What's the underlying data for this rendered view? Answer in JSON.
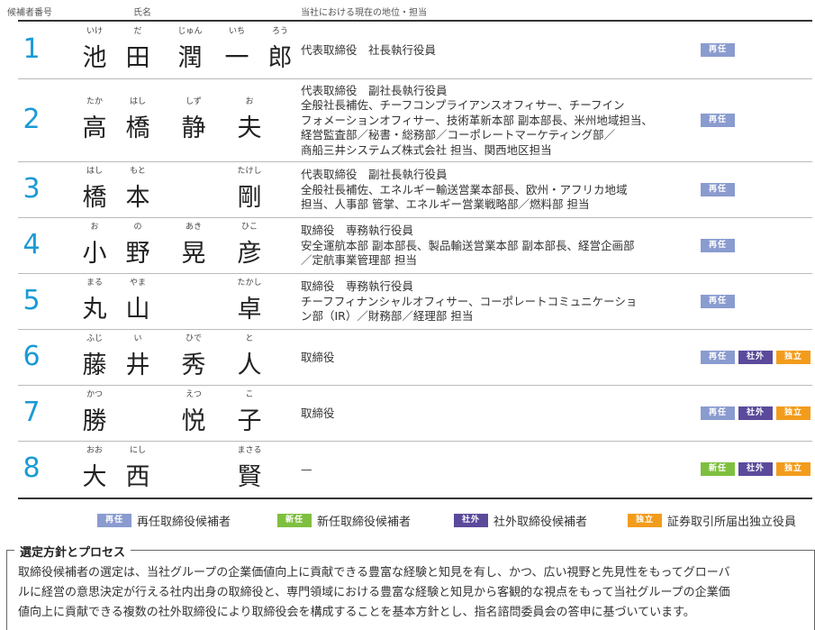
{
  "header": {
    "col_number": "候補者番号",
    "col_name": "氏名",
    "col_role": "当社における現在の地位・担当"
  },
  "candidates": [
    {
      "number": "1",
      "name": [
        {
          "k": "池",
          "f": "いけ"
        },
        {
          "k": "田",
          "f": "だ"
        },
        {
          "k": "潤",
          "f": "じゅん"
        },
        {
          "k": "一",
          "f": "いち"
        },
        {
          "k": "郎",
          "f": "ろう"
        }
      ],
      "role": [
        "代表取締役　社長執行役員"
      ],
      "badges": [
        "再任"
      ]
    },
    {
      "number": "2",
      "name": [
        {
          "k": "高",
          "f": "たか"
        },
        {
          "k": "橋",
          "f": "はし"
        },
        {
          "k": "静",
          "f": "しず"
        },
        {
          "k": "夫",
          "f": "お"
        }
      ],
      "role": [
        "代表取締役　副社長執行役員",
        "全般社長補佐、チーフコンプライアンスオフィサー、チーフイン",
        "フォメーションオフィサー、技術革新本部 副本部長、米州地域担当、",
        "経営監査部／秘書・総務部／コーポレートマーケティング部／",
        "商船三井システムズ株式会社 担当、関西地区担当"
      ],
      "badges": [
        "再任"
      ]
    },
    {
      "number": "3",
      "name": [
        {
          "k": "橋",
          "f": "はし"
        },
        {
          "k": "本",
          "f": "もと"
        },
        {
          "k": "",
          "f": ""
        },
        {
          "k": "剛",
          "f": "たけし"
        }
      ],
      "role": [
        "代表取締役　副社長執行役員",
        "全般社長補佐、エネルギー輸送営業本部長、欧州・アフリカ地域",
        "担当、人事部 管掌、エネルギー営業戦略部／燃料部 担当"
      ],
      "badges": [
        "再任"
      ]
    },
    {
      "number": "4",
      "name": [
        {
          "k": "小",
          "f": "お"
        },
        {
          "k": "野",
          "f": "の"
        },
        {
          "k": "晃",
          "f": "あき"
        },
        {
          "k": "彦",
          "f": "ひこ"
        }
      ],
      "role": [
        "取締役　専務執行役員",
        "安全運航本部 副本部長、製品輸送営業本部 副本部長、経営企画部",
        "／定航事業管理部 担当"
      ],
      "badges": [
        "再任"
      ]
    },
    {
      "number": "5",
      "name": [
        {
          "k": "丸",
          "f": "まる"
        },
        {
          "k": "山",
          "f": "やま"
        },
        {
          "k": "",
          "f": ""
        },
        {
          "k": "卓",
          "f": "たかし"
        }
      ],
      "role": [
        "取締役　専務執行役員",
        "チーフフィナンシャルオフィサー、コーポレートコミュニケーショ",
        "ン部（IR）／財務部／経理部 担当"
      ],
      "badges": [
        "再任"
      ]
    },
    {
      "number": "6",
      "name": [
        {
          "k": "藤",
          "f": "ふじ"
        },
        {
          "k": "井",
          "f": "い"
        },
        {
          "k": "秀",
          "f": "ひで"
        },
        {
          "k": "人",
          "f": "と"
        }
      ],
      "role": [
        "取締役"
      ],
      "badges": [
        "再任",
        "社外",
        "独立"
      ]
    },
    {
      "number": "7",
      "name": [
        {
          "k": "勝",
          "f": "かつ"
        },
        {
          "k": "",
          "f": ""
        },
        {
          "k": "悦",
          "f": "えつ"
        },
        {
          "k": "子",
          "f": "こ"
        }
      ],
      "role": [
        "取締役"
      ],
      "badges": [
        "再任",
        "社外",
        "独立"
      ]
    },
    {
      "number": "8",
      "name": [
        {
          "k": "大",
          "f": "おお"
        },
        {
          "k": "西",
          "f": "にし"
        },
        {
          "k": "",
          "f": ""
        },
        {
          "k": "賢",
          "f": "まさる"
        }
      ],
      "role": [
        "—"
      ],
      "badges": [
        "新任",
        "社外",
        "独立"
      ]
    }
  ],
  "legend": [
    {
      "badge": "再任",
      "label": "再任取締役候補者",
      "color": "#8a9bcf"
    },
    {
      "badge": "新任",
      "label": "新任取締役候補者",
      "color": "#7fbf3f"
    },
    {
      "badge": "社外",
      "label": "社外取締役候補者",
      "color": "#5b4a9b"
    },
    {
      "badge": "独立",
      "label": "証券取引所届出独立役員",
      "color": "#f29c1c"
    }
  ],
  "policy": {
    "title": "選定方針とプロセス",
    "lines": [
      "取締役候補者の選定は、当社グループの企業価値向上に貢献できる豊富な経験と知見を有し、かつ、広い視野と先見性をもってグローバ",
      "ルに経営の意思決定が行える社内出身の取締役と、専門領域における豊富な経験と知見から客観的な視点をもって当社グループの企業価",
      "値向上に貢献できる複数の社外取締役により取締役会を構成することを基本方針とし、指名諮問委員会の答申に基づいています。"
    ]
  }
}
